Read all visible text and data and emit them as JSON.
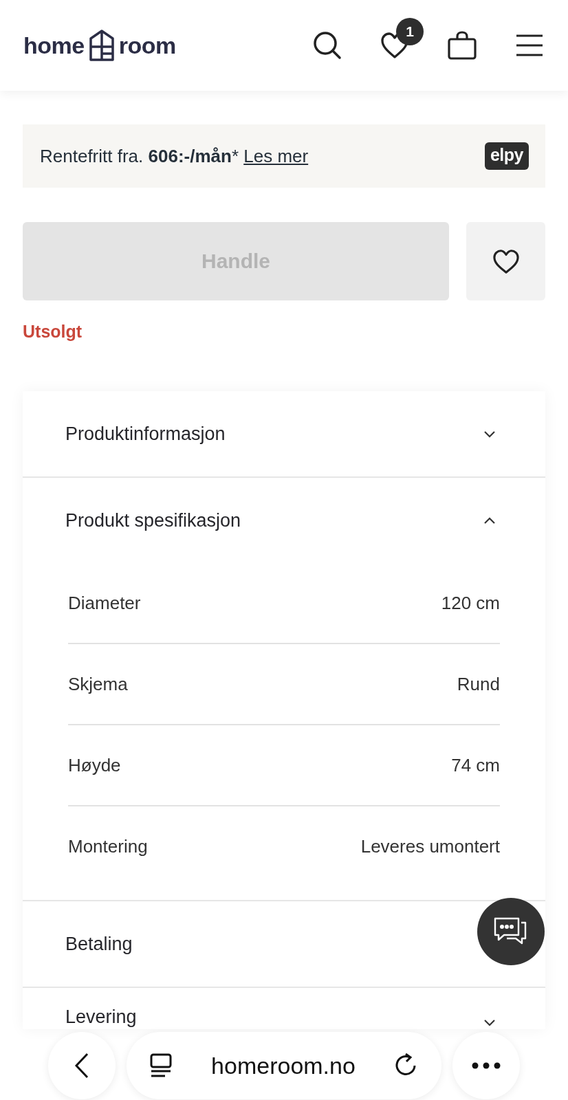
{
  "header": {
    "logo": {
      "left": "home",
      "right": "room"
    },
    "wishlist_count": "1"
  },
  "financing": {
    "prefix": "Rentefritt fra. ",
    "amount": "606:-/mån",
    "suffix": "*",
    "link": "Les mer",
    "provider": "elpy"
  },
  "buy": {
    "button": "Handle",
    "disabled": true,
    "stock_status": "Utsolgt"
  },
  "accordion": [
    {
      "title": "Produktinformasjon",
      "expanded": false
    },
    {
      "title": "Produkt spesifikasjon",
      "expanded": true,
      "specs": [
        {
          "label": "Diameter",
          "value": "120 cm"
        },
        {
          "label": "Skjema",
          "value": "Rund"
        },
        {
          "label": "Høyde",
          "value": "74 cm"
        },
        {
          "label": "Montering",
          "value": "Leveres umontert"
        }
      ]
    },
    {
      "title": "Betaling"
    },
    {
      "title": "Levering",
      "expanded": false
    }
  ],
  "browser_bar": {
    "address": "homeroom.no"
  }
}
